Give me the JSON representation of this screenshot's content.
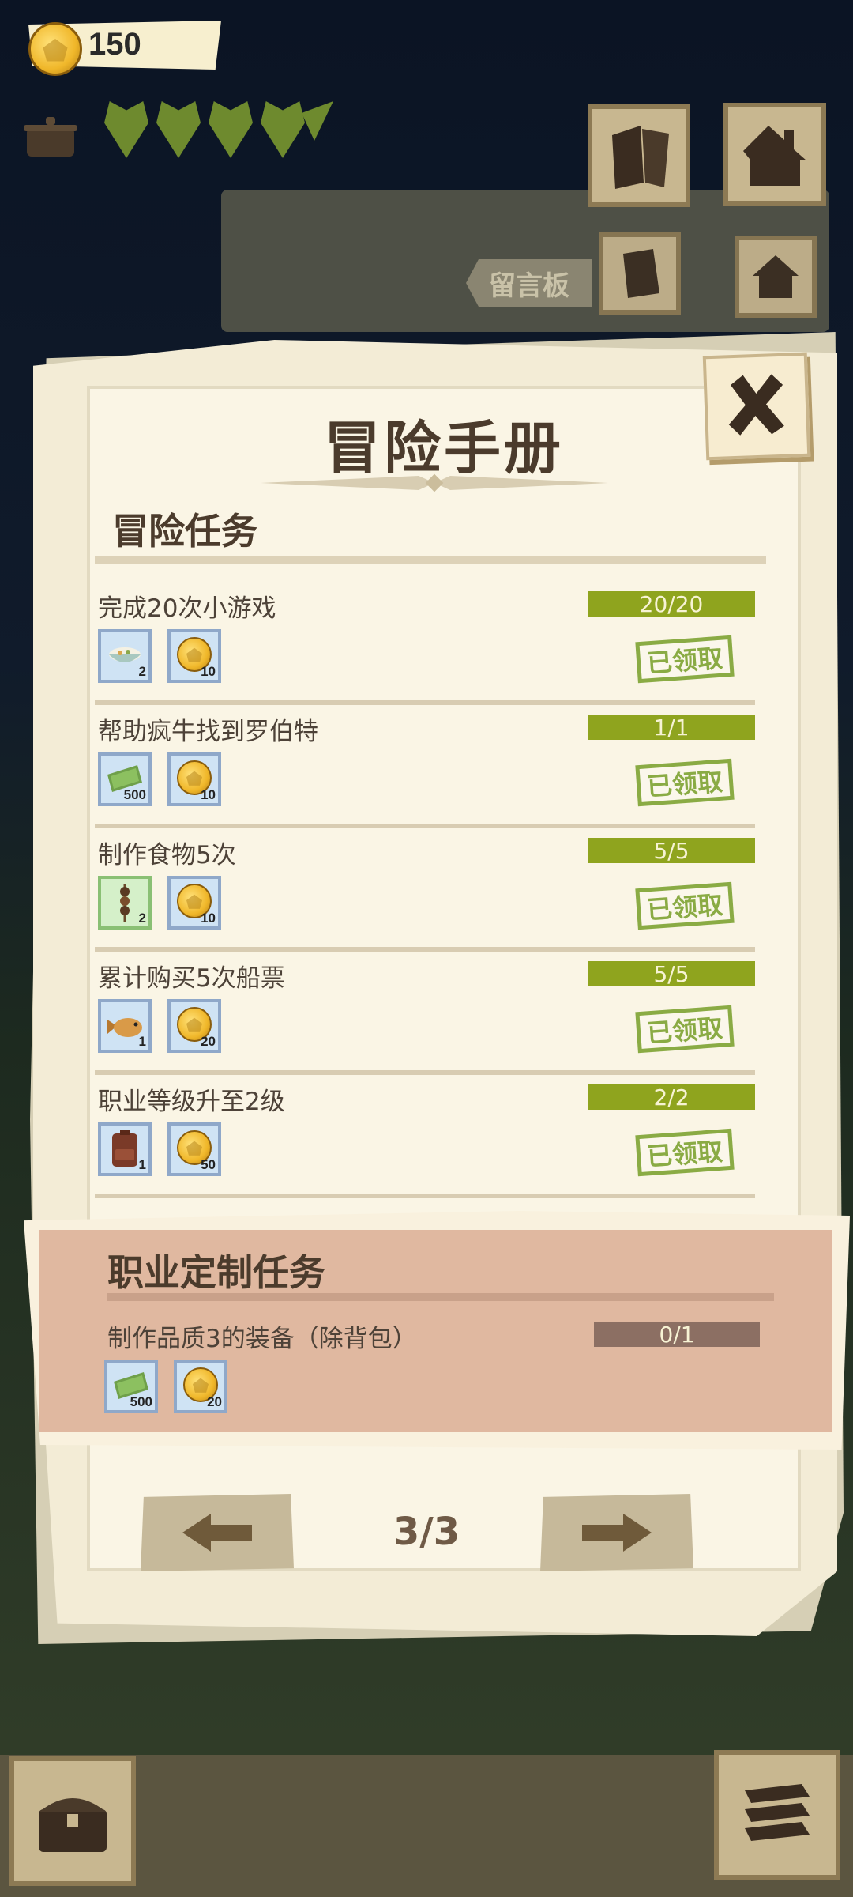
{
  "hud": {
    "coins": "150",
    "hearts": 4
  },
  "background_board": {
    "sign_label": "留言板"
  },
  "dialog": {
    "title": "冒险手册",
    "adventure_section_title": "冒险任务",
    "tasks": [
      {
        "name": "完成20次小游戏",
        "progress": "20/20",
        "rewards": [
          {
            "icon": "bowl-food-icon",
            "qty": "2"
          },
          {
            "icon": "coin-icon",
            "qty": "10"
          }
        ],
        "status": "已领取"
      },
      {
        "name": "帮助疯牛找到罗伯特",
        "progress": "1/1",
        "rewards": [
          {
            "icon": "cash-icon",
            "qty": "500"
          },
          {
            "icon": "coin-icon",
            "qty": "10"
          }
        ],
        "status": "已领取"
      },
      {
        "name": "制作食物5次",
        "progress": "5/5",
        "rewards": [
          {
            "icon": "skewer-icon",
            "qty": "2"
          },
          {
            "icon": "coin-icon",
            "qty": "10"
          }
        ],
        "status": "已领取"
      },
      {
        "name": "累计购买5次船票",
        "progress": "5/5",
        "rewards": [
          {
            "icon": "fish-icon",
            "qty": "1"
          },
          {
            "icon": "coin-icon",
            "qty": "20"
          }
        ],
        "status": "已领取"
      },
      {
        "name": "职业等级升至2级",
        "progress": "2/2",
        "rewards": [
          {
            "icon": "backpack-icon",
            "qty": "1"
          },
          {
            "icon": "coin-icon",
            "qty": "50"
          }
        ],
        "status": "已领取"
      }
    ],
    "career_section_title": "职业定制任务",
    "career_task": {
      "name": "制作品质3的装备（除背包）",
      "progress": "0/1",
      "rewards": [
        {
          "icon": "cash-icon",
          "qty": "500"
        },
        {
          "icon": "coin-icon",
          "qty": "20"
        }
      ]
    },
    "pagination": {
      "page": "3/3"
    }
  },
  "colors": {
    "progress_done": "#8fa41e",
    "progress_pending": "#8c6f63",
    "claimed_stamp": "#8aab44",
    "career_bg": "#e0b8a0",
    "paper": "#f3ecd6"
  }
}
